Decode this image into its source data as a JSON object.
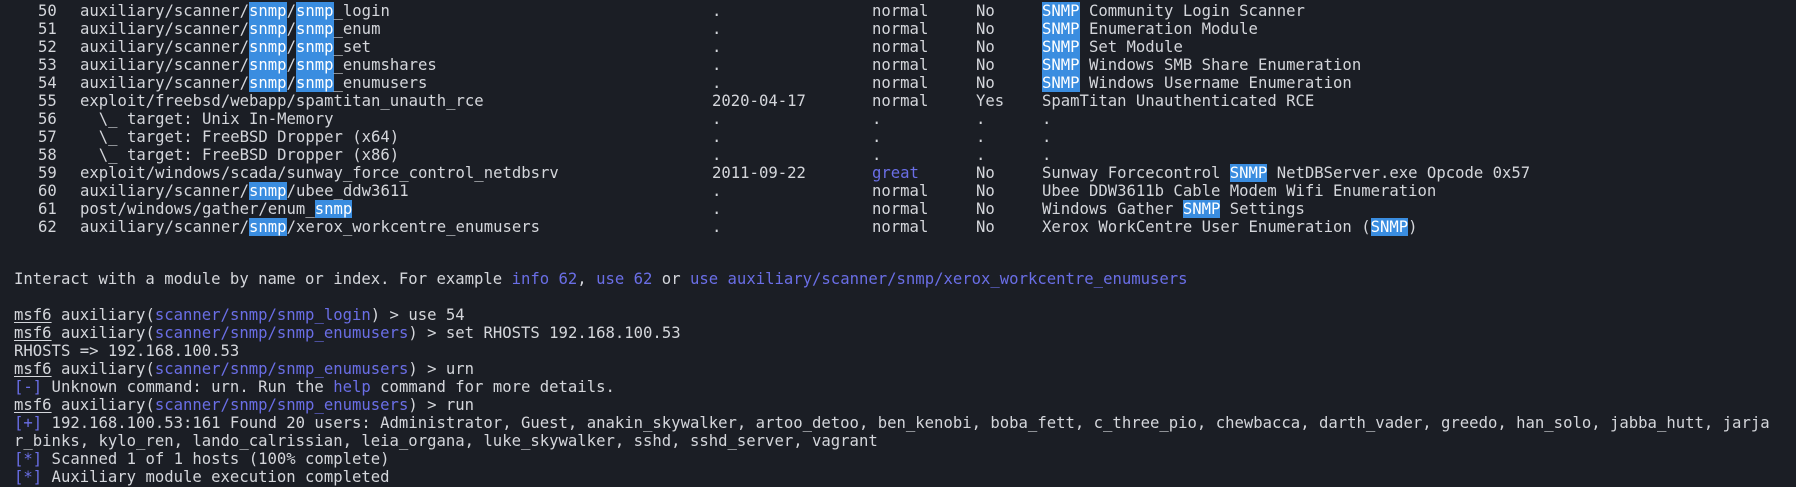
{
  "modules": [
    {
      "num": "50",
      "name": [
        {
          "t": "auxiliary/scanner/"
        },
        {
          "t": "snmp",
          "h": true
        },
        {
          "t": "/"
        },
        {
          "t": "snmp",
          "h": true
        },
        {
          "t": "_login"
        }
      ],
      "date": ".",
      "rank": "normal",
      "check": "No",
      "desc": [
        {
          "t": "SNMP",
          "h": true
        },
        {
          "t": " Community Login Scanner"
        }
      ]
    },
    {
      "num": "51",
      "name": [
        {
          "t": "auxiliary/scanner/"
        },
        {
          "t": "snmp",
          "h": true
        },
        {
          "t": "/"
        },
        {
          "t": "snmp",
          "h": true
        },
        {
          "t": "_enum"
        }
      ],
      "date": ".",
      "rank": "normal",
      "check": "No",
      "desc": [
        {
          "t": "SNMP",
          "h": true
        },
        {
          "t": " Enumeration Module"
        }
      ]
    },
    {
      "num": "52",
      "name": [
        {
          "t": "auxiliary/scanner/"
        },
        {
          "t": "snmp",
          "h": true
        },
        {
          "t": "/"
        },
        {
          "t": "snmp",
          "h": true
        },
        {
          "t": "_set"
        }
      ],
      "date": ".",
      "rank": "normal",
      "check": "No",
      "desc": [
        {
          "t": "SNMP",
          "h": true
        },
        {
          "t": " Set Module"
        }
      ]
    },
    {
      "num": "53",
      "name": [
        {
          "t": "auxiliary/scanner/"
        },
        {
          "t": "snmp",
          "h": true
        },
        {
          "t": "/"
        },
        {
          "t": "snmp",
          "h": true
        },
        {
          "t": "_enumshares"
        }
      ],
      "date": ".",
      "rank": "normal",
      "check": "No",
      "desc": [
        {
          "t": "SNMP",
          "h": true
        },
        {
          "t": " Windows SMB Share Enumeration"
        }
      ]
    },
    {
      "num": "54",
      "name": [
        {
          "t": "auxiliary/scanner/"
        },
        {
          "t": "snmp",
          "h": true
        },
        {
          "t": "/"
        },
        {
          "t": "snmp",
          "h": true
        },
        {
          "t": "_enumusers"
        }
      ],
      "date": ".",
      "rank": "normal",
      "check": "No",
      "desc": [
        {
          "t": "SNMP",
          "h": true
        },
        {
          "t": " Windows Username Enumeration"
        }
      ]
    },
    {
      "num": "55",
      "name": [
        {
          "t": "exploit/freebsd/webapp/spamtitan_unauth_rce"
        }
      ],
      "date": "2020-04-17",
      "rank": "normal",
      "check": "Yes",
      "desc": [
        {
          "t": "SpamTitan Unauthenticated RCE"
        }
      ]
    },
    {
      "num": "56",
      "name": [
        {
          "t": "  \\_ target: Unix In-Memory"
        }
      ],
      "date": ".",
      "rank": ".",
      "check": ".",
      "desc": [
        {
          "t": "."
        }
      ]
    },
    {
      "num": "57",
      "name": [
        {
          "t": "  \\_ target: FreeBSD Dropper (x64)"
        }
      ],
      "date": ".",
      "rank": ".",
      "check": ".",
      "desc": [
        {
          "t": "."
        }
      ]
    },
    {
      "num": "58",
      "name": [
        {
          "t": "  \\_ target: FreeBSD Dropper (x86)"
        }
      ],
      "date": ".",
      "rank": ".",
      "check": ".",
      "desc": [
        {
          "t": "."
        }
      ]
    },
    {
      "num": "59",
      "name": [
        {
          "t": "exploit/windows/scada/sunway_force_control_netdbsrv"
        }
      ],
      "date": "2011-09-22",
      "rank": "great",
      "check": "No",
      "desc": [
        {
          "t": "Sunway Forcecontrol "
        },
        {
          "t": "SNMP",
          "h": true
        },
        {
          "t": " NetDBServer.exe Opcode 0x57"
        }
      ]
    },
    {
      "num": "60",
      "name": [
        {
          "t": "auxiliary/scanner/"
        },
        {
          "t": "snmp",
          "h": true
        },
        {
          "t": "/ubee_ddw3611"
        }
      ],
      "date": ".",
      "rank": "normal",
      "check": "No",
      "desc": [
        {
          "t": "Ubee DDW3611b Cable Modem Wifi Enumeration"
        }
      ]
    },
    {
      "num": "61",
      "name": [
        {
          "t": "post/windows/gather/enum_"
        },
        {
          "t": "snmp",
          "h": true
        }
      ],
      "date": ".",
      "rank": "normal",
      "check": "No",
      "desc": [
        {
          "t": "Windows Gather "
        },
        {
          "t": "SNMP",
          "h": true
        },
        {
          "t": " Settings"
        }
      ]
    },
    {
      "num": "62",
      "name": [
        {
          "t": "auxiliary/scanner/"
        },
        {
          "t": "snmp",
          "h": true
        },
        {
          "t": "/xerox_workcentre_enumusers"
        }
      ],
      "date": ".",
      "rank": "normal",
      "check": "No",
      "desc": [
        {
          "t": "Xerox WorkCentre User Enumeration ("
        },
        {
          "t": "SNMP",
          "h": true
        },
        {
          "t": ")"
        }
      ]
    }
  ],
  "interact": {
    "prefix": "Interact with a module by name or index. For example ",
    "info_cmd": "info 62",
    "comma": ", ",
    "use_cmd": "use 62",
    "or": " or ",
    "use_path_cmd": "use auxiliary/scanner/snmp/xerox_workcentre_enumusers"
  },
  "session": [
    {
      "kind": "prompt",
      "msf": "msf6",
      "mod_pre": " auxiliary(",
      "mod": "scanner/snmp/snmp_login",
      "mod_post": ") > ",
      "cmd": "use 54"
    },
    {
      "kind": "prompt",
      "msf": "msf6",
      "mod_pre": " auxiliary(",
      "mod": "scanner/snmp/snmp_enumusers",
      "mod_post": ") > ",
      "cmd": "set RHOSTS 192.168.100.53"
    },
    {
      "kind": "text",
      "text": "RHOSTS => 192.168.100.53"
    },
    {
      "kind": "prompt",
      "msf": "msf6",
      "mod_pre": " auxiliary(",
      "mod": "scanner/snmp/snmp_enumusers",
      "mod_post": ") > ",
      "cmd": "urn"
    },
    {
      "kind": "error",
      "tag": "[-]",
      "pre": " Unknown command: urn. Run the ",
      "help": "help",
      "post": " command for more details."
    },
    {
      "kind": "prompt",
      "msf": "msf6",
      "mod_pre": " auxiliary(",
      "mod": "scanner/snmp/snmp_enumusers",
      "mod_post": ") > ",
      "cmd": "run"
    },
    {
      "kind": "status",
      "tag": "[+]",
      "text": " 192.168.100.53:161 Found 20 users: Administrator, Guest, anakin_skywalker, artoo_detoo, ben_kenobi, boba_fett, c_three_pio, chewbacca, darth_vader, greedo, han_solo, jabba_hutt, jarja"
    },
    {
      "kind": "text",
      "text": "r_binks, kylo_ren, lando_calrissian, leia_organa, luke_skywalker, sshd, sshd_server, vagrant"
    },
    {
      "kind": "status",
      "tag": "[*]",
      "text": " Scanned 1 of 1 hosts (100% complete)"
    },
    {
      "kind": "status",
      "tag": "[*]",
      "text": " Auxiliary module execution completed"
    }
  ],
  "colors": {
    "background": "#1b1e25",
    "foreground": "#d4d6db",
    "highlight": "#3a8de0",
    "accent": "#6a6ee6"
  }
}
